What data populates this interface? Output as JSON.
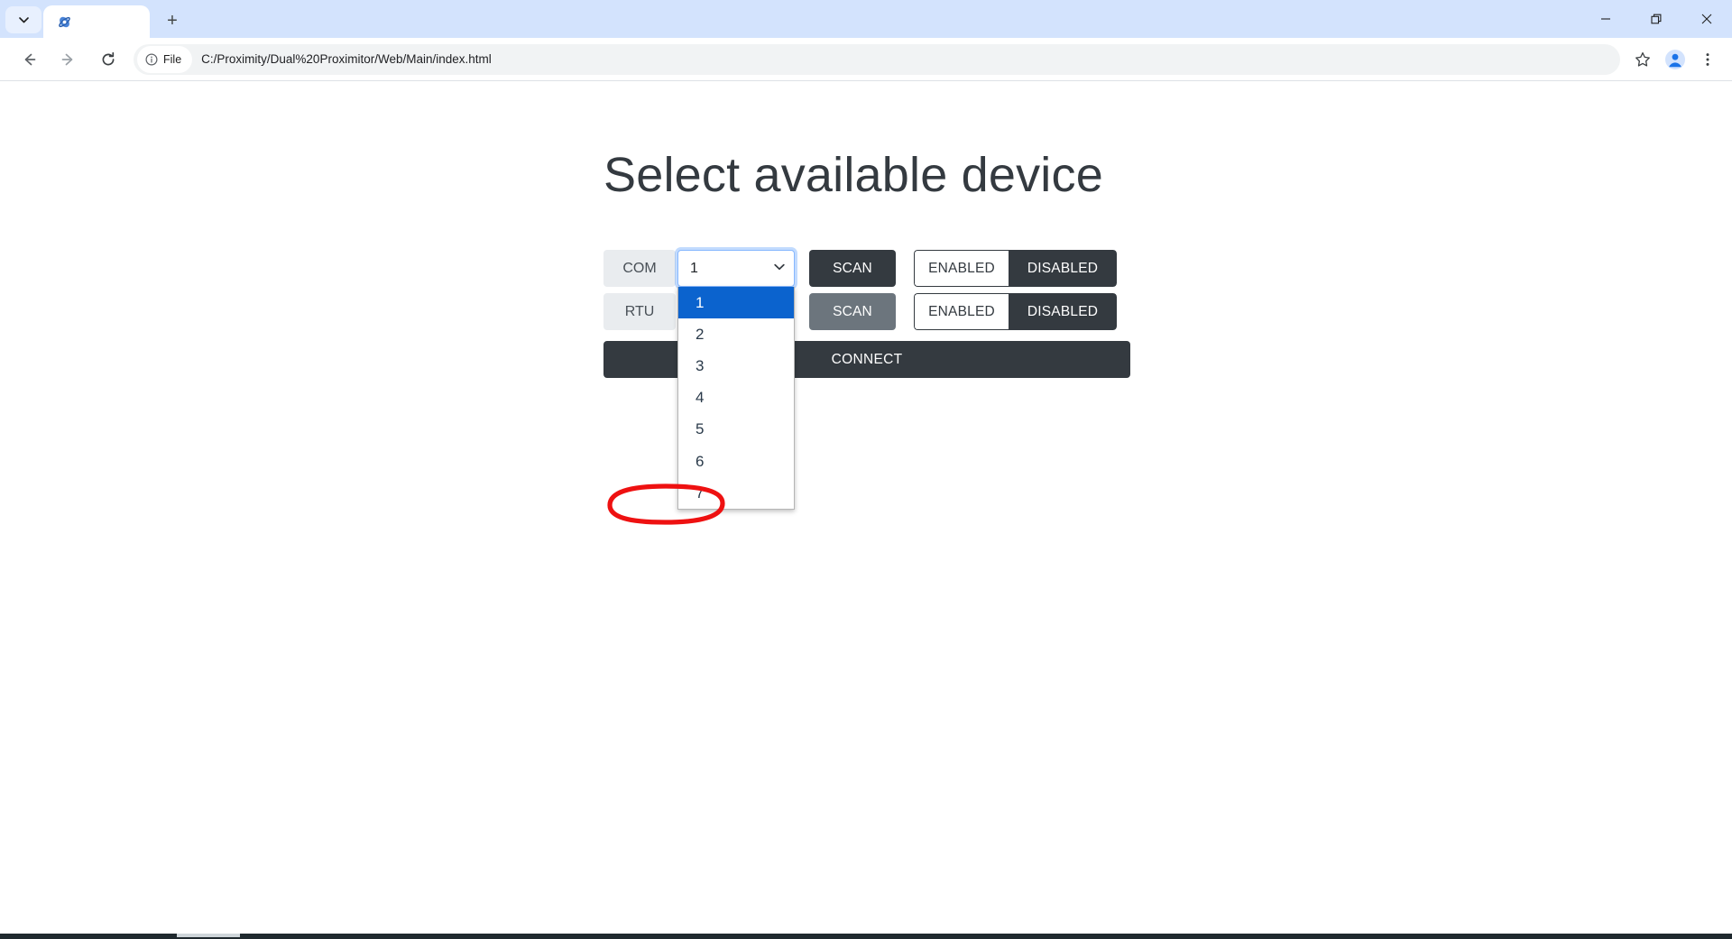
{
  "browser": {
    "tab": {
      "favicon": "globe-icon",
      "title": ""
    },
    "tab_list_chevron": "chevron-down-icon",
    "new_tab": "+",
    "window_controls": {
      "minimize": "minimize-icon",
      "maximize": "maximize-icon",
      "close": "close-icon"
    },
    "nav": {
      "back": "back-arrow-icon",
      "forward": "forward-arrow-icon",
      "reload": "reload-icon"
    },
    "omnibox": {
      "scheme_badge": "File",
      "info_icon": "info-circle-icon",
      "url": "C:/Proximity/Dual%20Proximitor/Web/Main/index.html"
    },
    "toolbar_icons": {
      "bookmark": "star-icon",
      "profile": "profile-avatar-icon",
      "menu": "three-dot-menu-icon"
    }
  },
  "page": {
    "title": "Select available device",
    "rows": [
      {
        "label": "COM",
        "select": {
          "value": "1",
          "caret": "chevron-down-icon",
          "focused": true
        },
        "scan_label": "SCAN",
        "scan_state": "active",
        "toggle": {
          "off_label": "ENABLED",
          "on_label": "DISABLED",
          "selected": "DISABLED"
        }
      },
      {
        "label": "RTU",
        "scan_label": "SCAN",
        "scan_state": "muted",
        "toggle": {
          "off_label": "ENABLED",
          "on_label": "DISABLED",
          "selected": "DISABLED"
        }
      }
    ],
    "connect_label": "CONNECT",
    "dropdown": {
      "open": true,
      "options": [
        "1",
        "2",
        "3",
        "4",
        "5",
        "6",
        "7"
      ],
      "selected_index": 0,
      "annotated_option": "7"
    }
  },
  "colors": {
    "dark": "#343a40",
    "muted_gray": "#6c757d",
    "label_bg": "#e9ecef",
    "highlight_blue": "#0b63ce",
    "focus_ring": "#86b7fe",
    "annotation_red": "#ee1111",
    "chrome_tabstrip": "#d3e3fd"
  }
}
